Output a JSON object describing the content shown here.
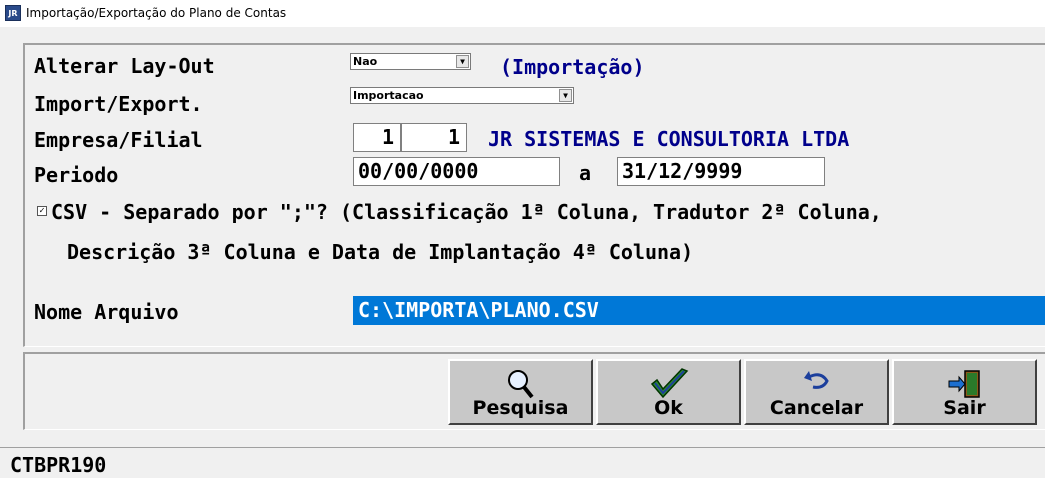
{
  "window": {
    "title": "Importação/Exportação do Plano de Contas",
    "app_icon": "JR"
  },
  "form": {
    "layout_label": "Alterar Lay-Out",
    "layout_value": "Nao",
    "mode_indicator": "(Importação)",
    "import_export_label": "Import/Export.",
    "import_export_value": "Importacao",
    "company_label": "Empresa/Filial",
    "company_code": "1",
    "branch_code": "1",
    "company_name": "JR SISTEMAS E CONSULTORIA LTDA",
    "period_label": "Periodo",
    "period_start": "00/00/0000",
    "period_sep": "a",
    "period_end": "31/12/9999",
    "csv_checked": true,
    "csv_line1": "CSV - Separado por \";\"? (Classificação 1ª Coluna, Tradutor 2ª Coluna,",
    "csv_line2": "Descrição 3ª Coluna e Data de Implantação 4ª Coluna)",
    "file_label": "Nome Arquivo",
    "file_value": "C:\\IMPORTA\\PLANO.CSV"
  },
  "buttons": {
    "search": "Pesquisa",
    "ok": "Ok",
    "cancel": "Cancelar",
    "exit": "Sair"
  },
  "status": {
    "program_code": "CTBPR190"
  },
  "icons": [
    "search-icon",
    "checkmark-icon",
    "undo-icon",
    "exit-door-icon",
    "dropdown-arrow-icon"
  ]
}
